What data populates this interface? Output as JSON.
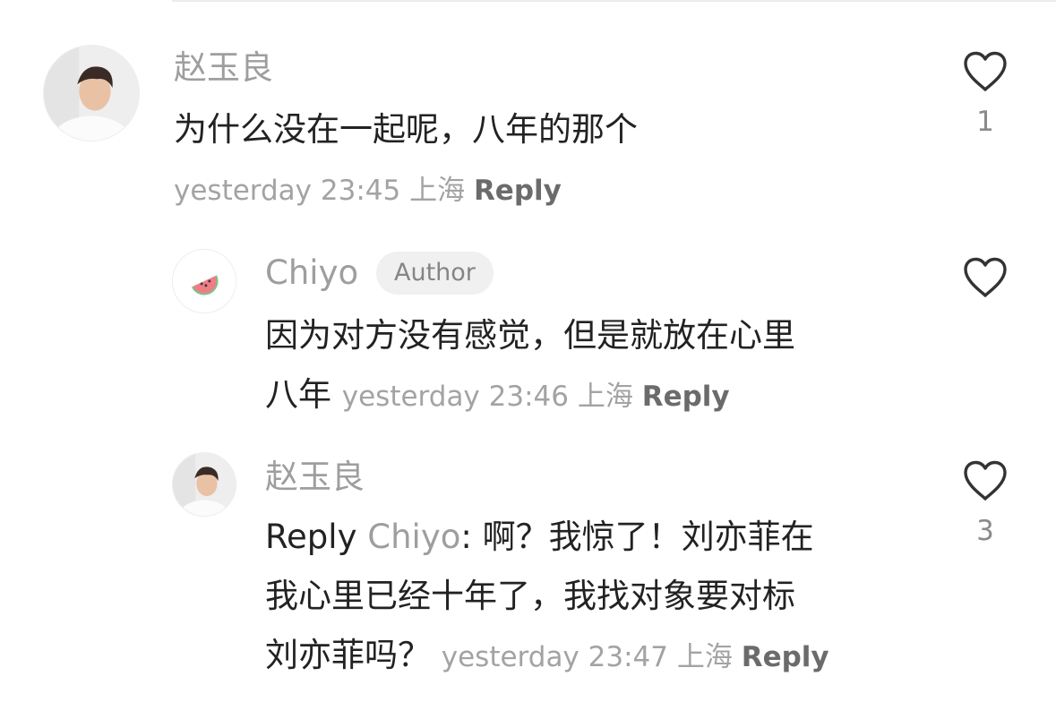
{
  "comments": [
    {
      "username": "赵玉良",
      "text": "为什么没在一起呢，八年的那个",
      "time": "yesterday 23:45",
      "location": "上海",
      "reply_label": "Reply",
      "likes": "1"
    },
    {
      "username": "Chiyo",
      "badge": "Author",
      "text_line1": "因为对方没有感觉，但是就放在心里",
      "text_line2": "八年",
      "time": "yesterday 23:46",
      "location": "上海",
      "reply_label": "Reply",
      "likes": ""
    },
    {
      "username": "赵玉良",
      "reply_prefix": "Reply",
      "mention": "Chiyo",
      "text_line1_rest": ": 啊？我惊了！刘亦菲在",
      "text_line2": "我心里已经十年了，我找对象要对标",
      "text_line3": "刘亦菲吗？",
      "time": "yesterday 23:47",
      "location": "上海",
      "reply_label": "Reply",
      "likes": "3"
    }
  ],
  "colors": {
    "username": "#9e9e9e",
    "text": "#222222",
    "meta": "#a3a3a3",
    "reply_link": "#6b6b6b",
    "badge_bg": "#f0f0f0",
    "watermelon_red": "#f07d86",
    "watermelon_green": "#7cc48a"
  },
  "icons": {
    "like": "heart-outline-icon",
    "avatar_watermelon": "watermelon-icon"
  }
}
